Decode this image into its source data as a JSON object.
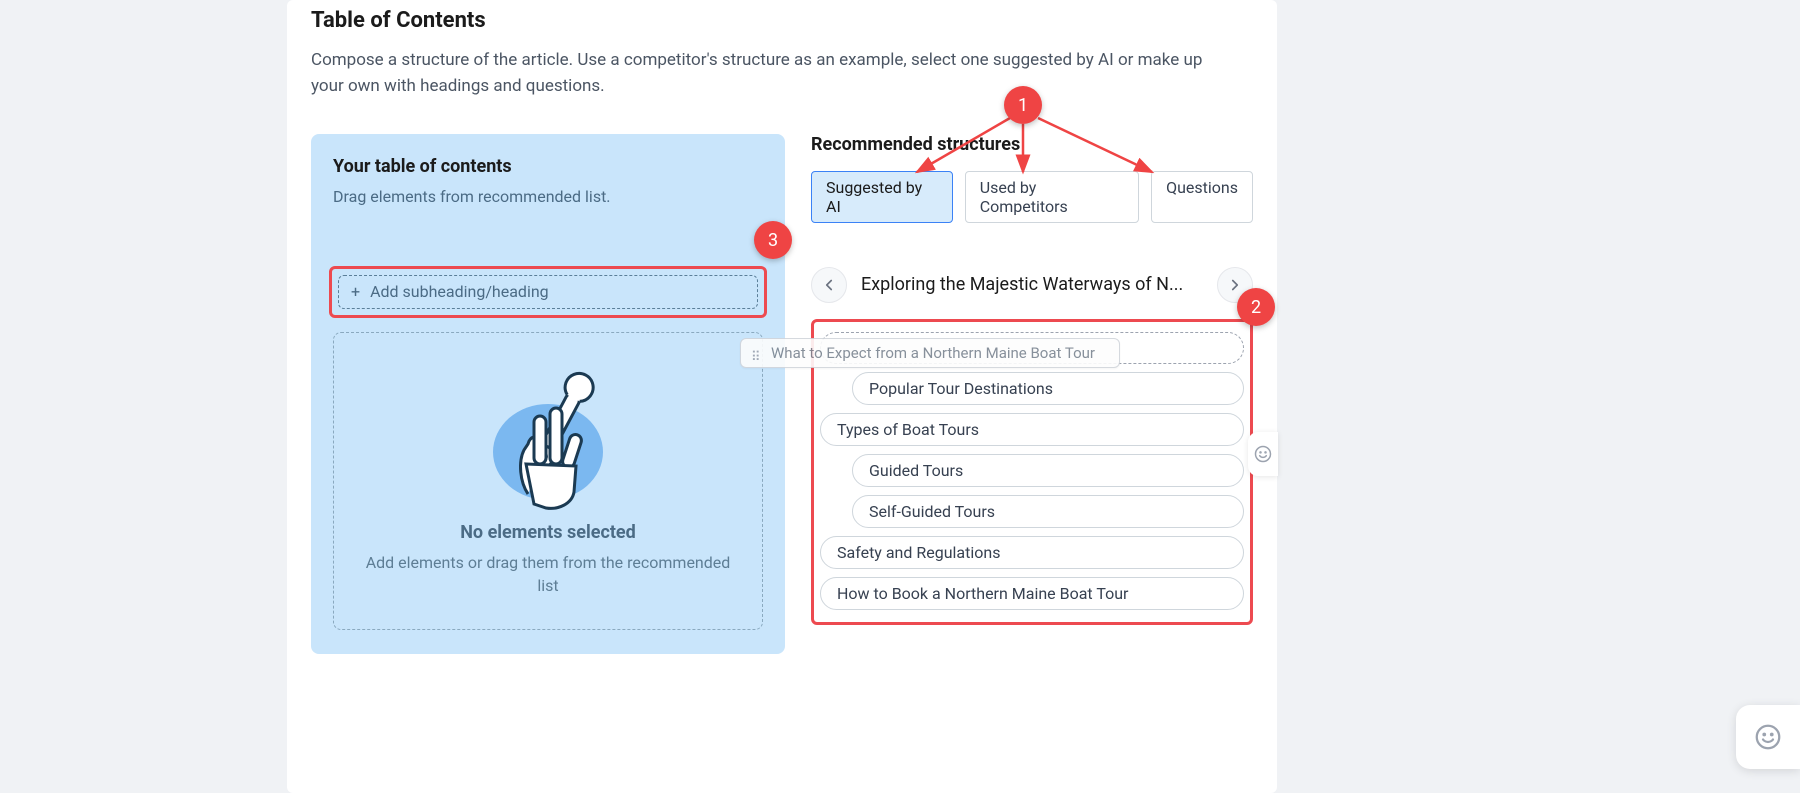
{
  "header": {
    "title": "Table of Contents",
    "subtitle": "Compose a structure of the article. Use a competitor's structure as an example, select one suggested by AI or make up your own with headings and questions."
  },
  "left": {
    "heading": "Your table of contents",
    "hint": "Drag elements from recommended list.",
    "add_label": "Add subheading/heading",
    "empty_title": "No elements selected",
    "empty_sub": "Add elements or drag them from the recommended list"
  },
  "right": {
    "heading": "Recommended structures",
    "tabs": {
      "ai": "Suggested by AI",
      "competitors": "Used by Competitors",
      "questions": "Questions"
    },
    "carousel_title": "Exploring the Majestic Waterways of N...",
    "dragging_item": "What to Expect from a Northern Maine Boat Tour",
    "items": [
      {
        "label": "Popular Tour Destinations",
        "level": 2
      },
      {
        "label": "Types of Boat Tours",
        "level": 1
      },
      {
        "label": "Guided Tours",
        "level": 2
      },
      {
        "label": "Self-Guided Tours",
        "level": 2
      },
      {
        "label": "Safety and Regulations",
        "level": 1
      },
      {
        "label": "How to Book a Northern Maine Boat Tour",
        "level": 1
      }
    ]
  },
  "annotations": {
    "b1": "1",
    "b2": "2",
    "b3": "3"
  },
  "colors": {
    "accent_red": "#ef4444",
    "accent_blue": "#3b82f6",
    "panel_blue": "#c9e5fb"
  }
}
